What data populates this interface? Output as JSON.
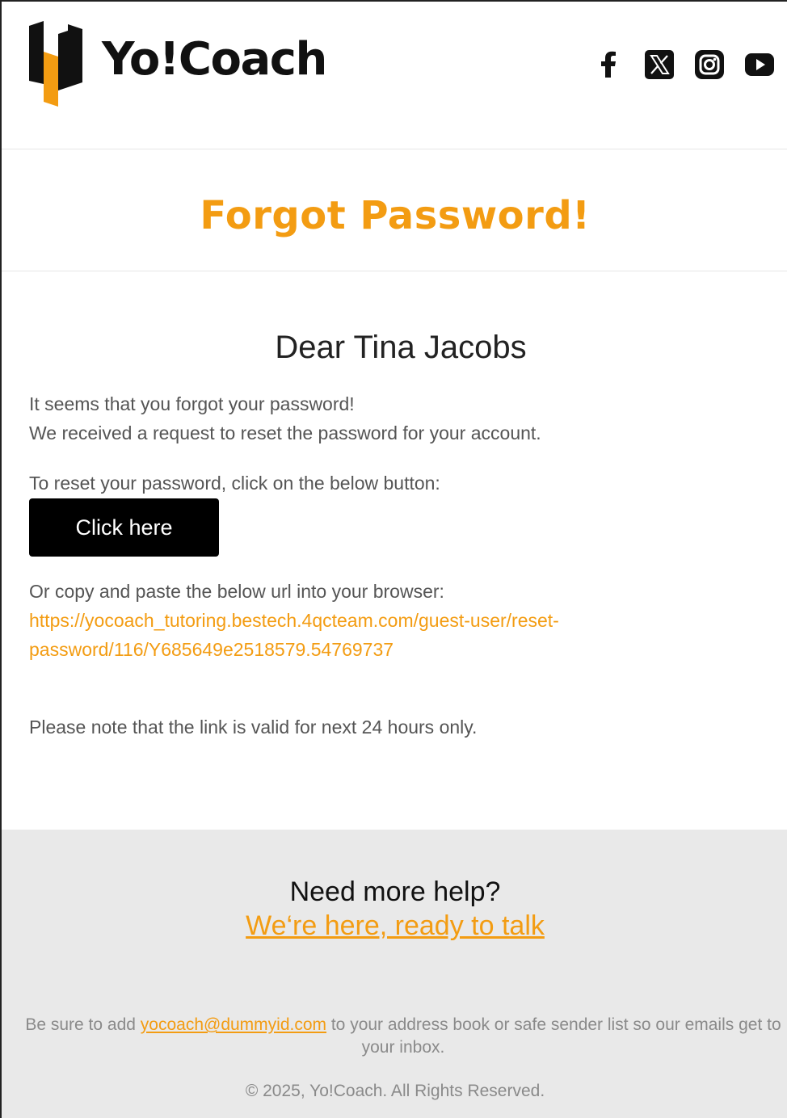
{
  "brand": {
    "name": "Yo!Coach",
    "accent_color": "#f39c12",
    "dark_color": "#111111"
  },
  "social": [
    {
      "name": "facebook-icon"
    },
    {
      "name": "x-twitter-icon"
    },
    {
      "name": "instagram-icon"
    },
    {
      "name": "youtube-icon"
    }
  ],
  "title": "Forgot Password!",
  "greeting": "Dear Tina Jacobs",
  "body": {
    "line1": "It seems that you forgot your password!",
    "line2": "We received a request to reset the password for your account.",
    "reset_instruction": "To reset your password, click on the below button:",
    "button_label": "Click here",
    "copy_instruction": "Or copy and paste the below url into your browser:",
    "url_line1": "https://yocoach_tutoring.bestech.4qcteam.com/guest-user/reset-",
    "url_line2": "password/116/Y685649e2518579.54769737",
    "validity_note": "Please note that the link is valid for next 24 hours only."
  },
  "footer": {
    "help_question": "Need more help?",
    "help_link": "We‘re here, ready to talk",
    "note_prefix": "Be sure to add ",
    "note_email": "yocoach@dummyid.com",
    "note_suffix": " to your address book or safe sender list so our emails get to your inbox.",
    "copyright": "© 2025, Yo!Coach. All Rights Reserved."
  }
}
